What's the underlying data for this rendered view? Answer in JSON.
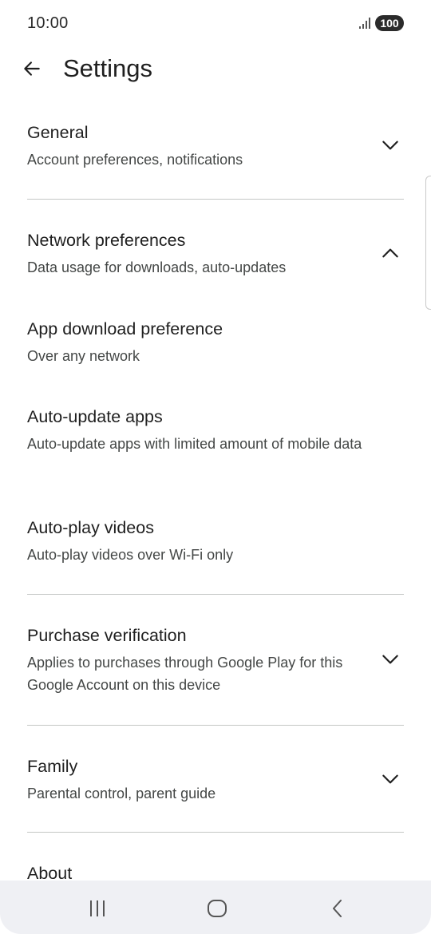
{
  "status_bar": {
    "time": "10:00",
    "battery": "100"
  },
  "app_bar": {
    "title": "Settings",
    "back_icon": "arrow-back-icon"
  },
  "sections": [
    {
      "id": "general",
      "title": "General",
      "subtitle": "Account preferences, notifications",
      "expanded": false
    },
    {
      "id": "network",
      "title": "Network preferences",
      "subtitle": "Data usage for downloads, auto-updates",
      "expanded": true,
      "items": [
        {
          "title": "App download preference",
          "subtitle": "Over any network"
        },
        {
          "title": "Auto-update apps",
          "subtitle": "Auto-update apps with limited amount of mobile data"
        },
        {
          "title": "Auto-play videos",
          "subtitle": "Auto-play videos over Wi-Fi only"
        }
      ]
    },
    {
      "id": "purchase",
      "title": "Purchase verification",
      "subtitle": "Applies to purchases through Google Play for this Google Account on this device",
      "expanded": false
    },
    {
      "id": "family",
      "title": "Family",
      "subtitle": "Parental control, parent guide",
      "expanded": false
    },
    {
      "id": "about",
      "title": "About"
    }
  ],
  "nav_bar": {
    "recents_icon": "recents-icon",
    "home_icon": "home-icon",
    "back_icon": "back-icon"
  },
  "colors": {
    "text_primary": "#1f1f1f",
    "text_secondary": "#444746",
    "divider": "#c4c7c5",
    "nav_bg": "#eff0f4"
  }
}
